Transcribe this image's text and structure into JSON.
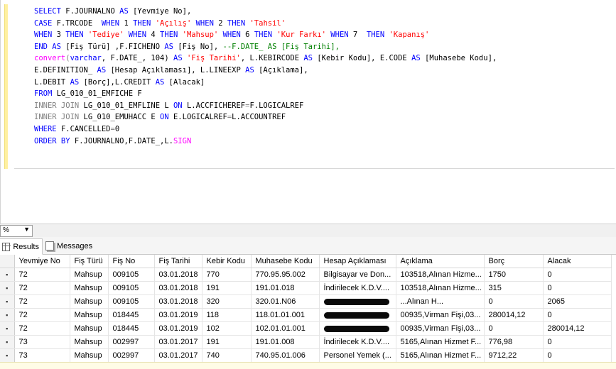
{
  "editor": {
    "lines": [
      [
        {
          "t": "SELECT ",
          "c": "kw"
        },
        {
          "t": "F.JOURNALNO ",
          "c": ""
        },
        {
          "t": "AS ",
          "c": "kw"
        },
        {
          "t": "[Yevmiye No],",
          "c": ""
        }
      ],
      [
        {
          "t": "CASE ",
          "c": "kw"
        },
        {
          "t": "F.TRCODE  ",
          "c": ""
        },
        {
          "t": "WHEN ",
          "c": "kw"
        },
        {
          "t": "1 ",
          "c": ""
        },
        {
          "t": "THEN ",
          "c": "kw"
        },
        {
          "t": "'Açılış' ",
          "c": "str"
        },
        {
          "t": "WHEN ",
          "c": "kw"
        },
        {
          "t": "2 ",
          "c": ""
        },
        {
          "t": "THEN ",
          "c": "kw"
        },
        {
          "t": "'Tahsil'",
          "c": "str"
        }
      ],
      [
        {
          "t": "WHEN ",
          "c": "kw"
        },
        {
          "t": "3 ",
          "c": ""
        },
        {
          "t": "THEN ",
          "c": "kw"
        },
        {
          "t": "'Tediye' ",
          "c": "str"
        },
        {
          "t": "WHEN ",
          "c": "kw"
        },
        {
          "t": "4 ",
          "c": ""
        },
        {
          "t": "THEN ",
          "c": "kw"
        },
        {
          "t": "'Mahsup' ",
          "c": "str"
        },
        {
          "t": "WHEN ",
          "c": "kw"
        },
        {
          "t": "6 ",
          "c": ""
        },
        {
          "t": "THEN ",
          "c": "kw"
        },
        {
          "t": "'Kur Farkı' ",
          "c": "str"
        },
        {
          "t": "WHEN ",
          "c": "kw"
        },
        {
          "t": "7  ",
          "c": ""
        },
        {
          "t": "THEN ",
          "c": "kw"
        },
        {
          "t": "'Kapanış'",
          "c": "str"
        }
      ],
      [
        {
          "t": "END ",
          "c": "kw"
        },
        {
          "t": "AS ",
          "c": "kw"
        },
        {
          "t": "[Fiş Türü] ,F.FICHENO ",
          "c": ""
        },
        {
          "t": "AS ",
          "c": "kw"
        },
        {
          "t": "[Fiş No], ",
          "c": ""
        },
        {
          "t": "--F.DATE_ AS [Fiş Tarihi],",
          "c": "cm"
        }
      ],
      [
        {
          "t": "convert",
          "c": "fn"
        },
        {
          "t": "(",
          "c": "gr"
        },
        {
          "t": "varchar",
          "c": "kw"
        },
        {
          "t": ", F.DATE_, 104) ",
          "c": ""
        },
        {
          "t": "AS ",
          "c": "kw"
        },
        {
          "t": "'Fiş Tarihi'",
          "c": "str"
        },
        {
          "t": ", L.KEBIRCODE ",
          "c": ""
        },
        {
          "t": "AS ",
          "c": "kw"
        },
        {
          "t": "[Kebir Kodu], E.CODE ",
          "c": ""
        },
        {
          "t": "AS ",
          "c": "kw"
        },
        {
          "t": "[Muhasebe Kodu],",
          "c": ""
        }
      ],
      [
        {
          "t": "E.DEFINITION_ ",
          "c": ""
        },
        {
          "t": "AS ",
          "c": "kw"
        },
        {
          "t": "[Hesap Açıklaması], L.LINEEXP ",
          "c": ""
        },
        {
          "t": "AS ",
          "c": "kw"
        },
        {
          "t": "[Açıklama],",
          "c": ""
        }
      ],
      [
        {
          "t": "L.DEBIT ",
          "c": ""
        },
        {
          "t": "AS ",
          "c": "kw"
        },
        {
          "t": "[Borç],L.CREDIT ",
          "c": ""
        },
        {
          "t": "AS ",
          "c": "kw"
        },
        {
          "t": "[Alacak]",
          "c": ""
        }
      ],
      [
        {
          "t": "FROM ",
          "c": "kw"
        },
        {
          "t": "LG_010_01_EMFICHE F",
          "c": ""
        }
      ],
      [
        {
          "t": "INNER JOIN ",
          "c": "gr"
        },
        {
          "t": "LG_010_01_EMFLINE L ",
          "c": ""
        },
        {
          "t": "ON ",
          "c": "kw"
        },
        {
          "t": "L.ACCFICHEREF",
          "c": ""
        },
        {
          "t": "=",
          "c": "gr"
        },
        {
          "t": "F.LOGICALREF",
          "c": ""
        }
      ],
      [
        {
          "t": "INNER JOIN ",
          "c": "gr"
        },
        {
          "t": "LG_010_EMUHACC E ",
          "c": ""
        },
        {
          "t": "ON ",
          "c": "kw"
        },
        {
          "t": "E.LOGICALREF",
          "c": ""
        },
        {
          "t": "=",
          "c": "gr"
        },
        {
          "t": "L.ACCOUNTREF",
          "c": ""
        }
      ],
      [
        {
          "t": "WHERE ",
          "c": "kw"
        },
        {
          "t": "F.CANCELLED",
          "c": ""
        },
        {
          "t": "=",
          "c": "gr"
        },
        {
          "t": "0",
          "c": ""
        }
      ],
      [
        {
          "t": "ORDER BY ",
          "c": "kw"
        },
        {
          "t": "F.JOURNALNO,F.DATE_,L.",
          "c": ""
        },
        {
          "t": "SIGN",
          "c": "fn"
        }
      ]
    ]
  },
  "zoom": {
    "value": "%"
  },
  "tabs": {
    "results": "Results",
    "messages": "Messages"
  },
  "grid": {
    "columns": [
      "Yevmiye No",
      "Fiş Türü",
      "Fiş No",
      "Fiş Tarihi",
      "Kebir Kodu",
      "Muhasebe Kodu",
      "Hesap Açıklaması",
      "Açıklama",
      "Borç",
      "Alacak"
    ],
    "rows": [
      [
        "72",
        "Mahsup",
        "009105",
        "03.01.2018",
        "770",
        "770.95.95.002",
        "Bilgisayar ve Don...",
        "103518,Alınan Hizme...",
        "1750",
        "0"
      ],
      [
        "72",
        "Mahsup",
        "009105",
        "03.01.2018",
        "191",
        "191.01.018",
        "İndirilecek K.D.V....",
        "103518,Alınan Hizme...",
        "315",
        "0"
      ],
      [
        "72",
        "Mahsup",
        "009105",
        "03.01.2018",
        "320",
        "320.01.N06",
        "",
        "...Alınan H...",
        "0",
        "2065"
      ],
      [
        "72",
        "Mahsup",
        "018445",
        "03.01.2019",
        "118",
        "118.01.01.001",
        "",
        "00935,Virman Fişi,03...",
        "280014,12",
        "0"
      ],
      [
        "72",
        "Mahsup",
        "018445",
        "03.01.2019",
        "102",
        "102.01.01.001",
        "",
        "00935,Virman Fişi,03...",
        "0",
        "280014,12"
      ],
      [
        "73",
        "Mahsup",
        "002997",
        "03.01.2017",
        "191",
        "191.01.008",
        "İndirilecek K.D.V....",
        "5165,Alınan Hizmet F...",
        "776,98",
        "0"
      ],
      [
        "73",
        "Mahsup",
        "002997",
        "03.01.2017",
        "740",
        "740.95.01.006",
        "Personel Yemek (...",
        "5165,Alınan Hizmet F...",
        "9712,22",
        "0"
      ]
    ],
    "redacted_rows": [
      2,
      3,
      4
    ]
  }
}
